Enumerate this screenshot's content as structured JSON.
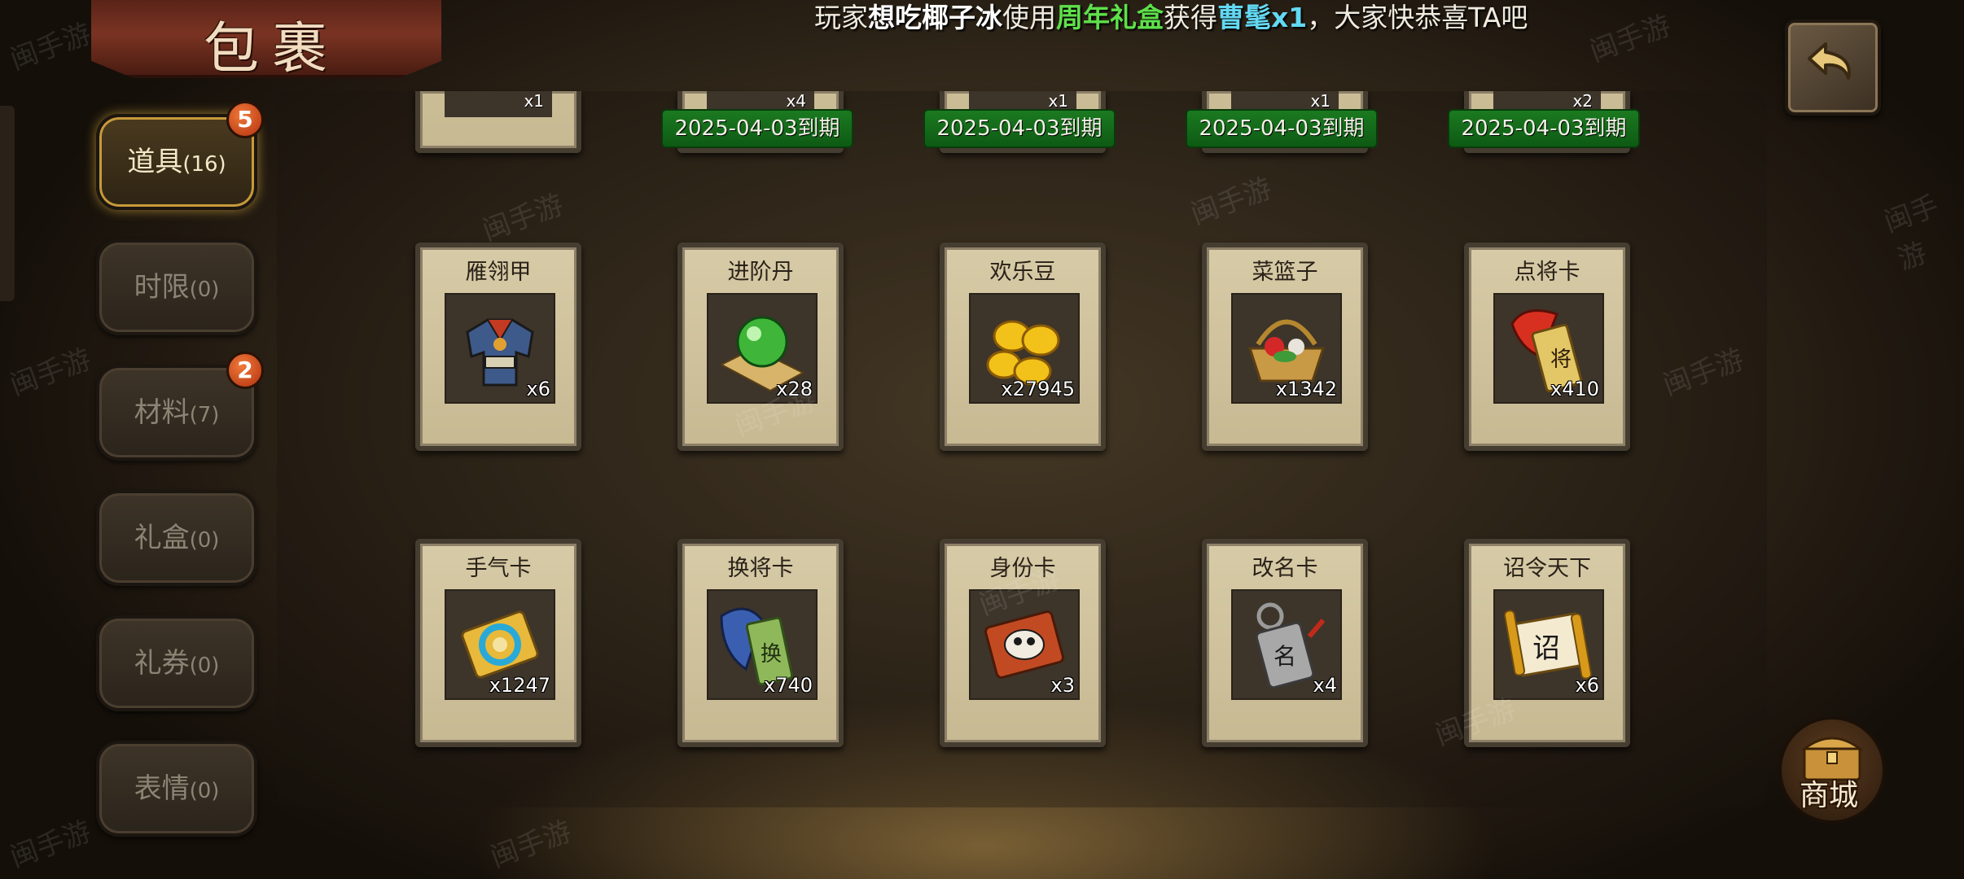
{
  "title": "包裹",
  "broadcast": {
    "prefix": "玩家",
    "player": "想吃椰子冰",
    "verb": "使用",
    "item": "周年礼盒",
    "got": "获得",
    "reward": "曹髦x1",
    "suffix": "，大家快恭喜TA吧"
  },
  "tabs": [
    {
      "label": "道具",
      "count": "(16)",
      "badge": "5",
      "active": true
    },
    {
      "label": "时限",
      "count": "(0)",
      "badge": null,
      "active": false
    },
    {
      "label": "材料",
      "count": "(7)",
      "badge": "2",
      "active": false
    },
    {
      "label": "礼盒",
      "count": "(0)",
      "badge": null,
      "active": false
    },
    {
      "label": "礼券",
      "count": "(0)",
      "badge": null,
      "active": false
    },
    {
      "label": "表情",
      "count": "(0)",
      "badge": null,
      "active": false
    }
  ],
  "top_row": [
    {
      "qty": "x1",
      "expiry": ""
    },
    {
      "qty": "x4",
      "expiry": "2025-04-03到期"
    },
    {
      "qty": "x1",
      "expiry": "2025-04-03到期"
    },
    {
      "qty": "x1",
      "expiry": "2025-04-03到期"
    },
    {
      "qty": "x2",
      "expiry": "2025-04-03到期"
    }
  ],
  "items": [
    {
      "name": "雁翎甲",
      "qty": "x6",
      "icon": "armor-icon"
    },
    {
      "name": "进阶丹",
      "qty": "x28",
      "icon": "pill-orb-icon"
    },
    {
      "name": "欢乐豆",
      "qty": "x27945",
      "icon": "gold-beans-icon"
    },
    {
      "name": "菜篮子",
      "qty": "x1342",
      "icon": "basket-icon"
    },
    {
      "name": "点将卡",
      "qty": "x410",
      "icon": "general-card-icon"
    },
    {
      "name": "手气卡",
      "qty": "x1247",
      "icon": "luck-card-icon"
    },
    {
      "name": "换将卡",
      "qty": "x740",
      "icon": "swap-card-icon"
    },
    {
      "name": "身份卡",
      "qty": "x3",
      "icon": "identity-card-icon"
    },
    {
      "name": "改名卡",
      "qty": "x4",
      "icon": "rename-card-icon"
    },
    {
      "name": "诏令天下",
      "qty": "x6",
      "icon": "edict-scroll-icon"
    }
  ],
  "shop": {
    "label": "商城"
  },
  "watermark": "闽手游"
}
